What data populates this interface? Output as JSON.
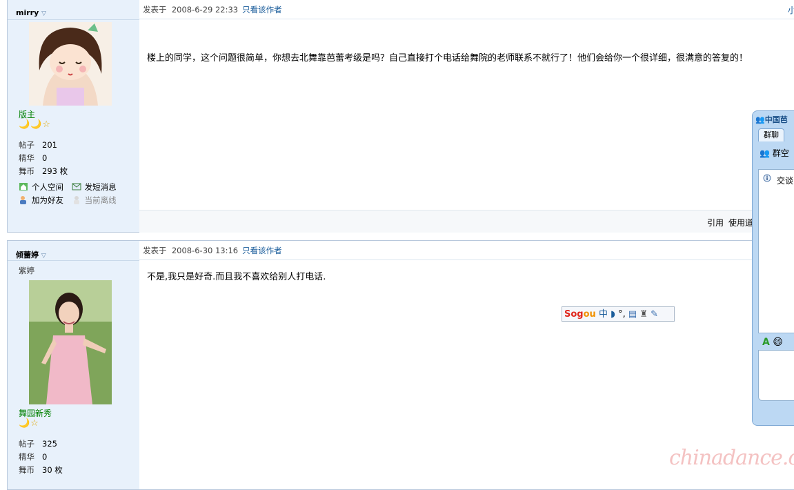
{
  "posts": [
    {
      "author": "mirry",
      "rank": "版主",
      "stars": "🌙🌙☆",
      "stats": [
        {
          "key": "帖子",
          "value": "201"
        },
        {
          "key": "精华",
          "value": "0"
        },
        {
          "key": "舞币",
          "value": "293 枚"
        }
      ],
      "links": {
        "space": "个人空间",
        "message": "发短消息",
        "add_friend": "加为好友",
        "status": "当前离线"
      },
      "posted_prefix": "发表于",
      "posted_time": "2008-6-29 22:33",
      "only_author": "只看该作者",
      "body": "楼上的同学，这个问题很简单，你想去北舞靠芭蕾考级是吗？自己直接打个电话给舞院的老师联系不就行了！他们会给你一个很详细，很满意的答复的！",
      "footer": {
        "quote": "引用",
        "use_tool": "使用道"
      }
    },
    {
      "author": "倾蕾婷",
      "title": "紫婷",
      "rank": "舞园新秀",
      "stars": "🌙☆",
      "stats": [
        {
          "key": "帖子",
          "value": "325"
        },
        {
          "key": "精华",
          "value": "0"
        },
        {
          "key": "舞币",
          "value": "30 枚"
        }
      ],
      "posted_prefix": "发表于",
      "posted_time": "2008-6-30 13:16",
      "only_author": "只看该作者",
      "body": "不是,我只是好奇.而且我不喜欢给别人打电话."
    }
  ],
  "top_right_cut": "小",
  "chat_panel": {
    "title": "中国芭",
    "tab": "群聊",
    "group": "群空",
    "notice": "交谈"
  },
  "ime_bar": {
    "logo_a": "Sog",
    "logo_b": "ou",
    "mode": "中",
    "punct": "°,"
  },
  "watermark": "chinadance.cn"
}
